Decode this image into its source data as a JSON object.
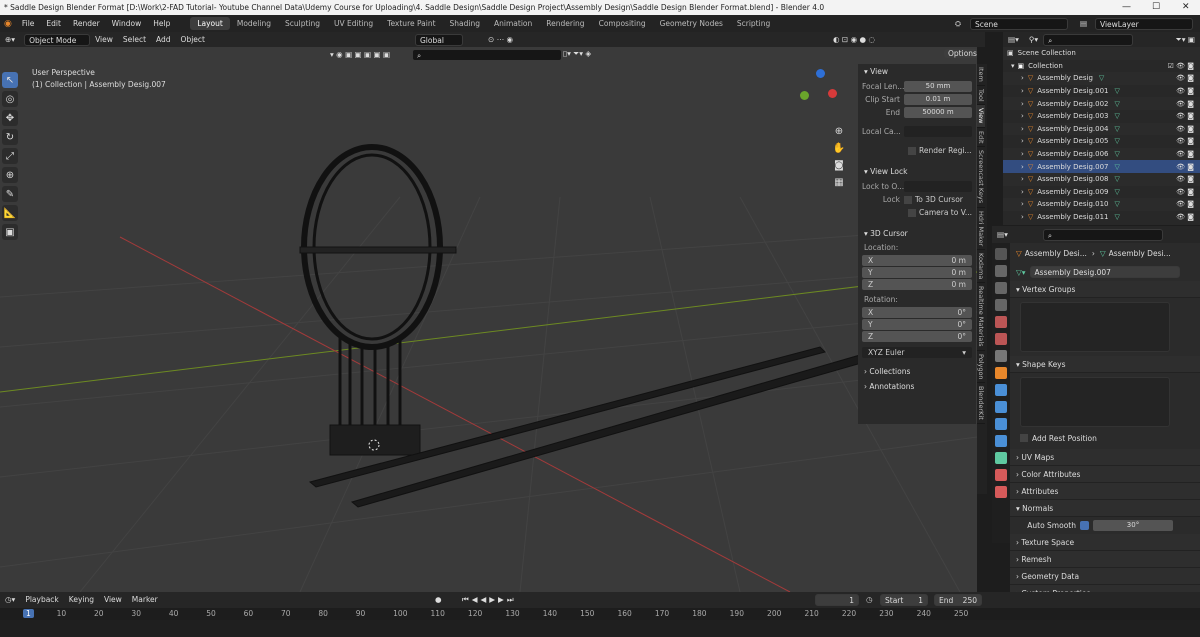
{
  "window": {
    "title": "* Saddle Design Blender Format [D:\\Work\\2-FAD Tutorial- Youtube Channel Data\\Udemy Course for Uploading\\4. Saddle Design\\Saddle Design Project\\Assembly Design\\Saddle Design Blender Format.blend] - Blender 4.0",
    "minimize": "—",
    "maximize": "☐",
    "close": "✕"
  },
  "menus": [
    "File",
    "Edit",
    "Render",
    "Window",
    "Help"
  ],
  "workspaces": [
    "Layout",
    "Modeling",
    "Sculpting",
    "UV Editing",
    "Texture Paint",
    "Shading",
    "Animation",
    "Rendering",
    "Compositing",
    "Geometry Nodes",
    "Scripting"
  ],
  "scene": {
    "name": "Scene",
    "view_layer": "ViewLayer"
  },
  "viewport_header": {
    "mode": "Object Mode",
    "view": "View",
    "select": "Select",
    "add": "Add",
    "object": "Object",
    "orientation": "Global",
    "options": "Options"
  },
  "viewport": {
    "perspective": "User Perspective",
    "collection_info": "(1) Collection | Assembly Desig.007"
  },
  "npanel": {
    "view_title": "View",
    "focal_label": "Focal Len...",
    "focal_value": "50 mm",
    "clip_start_label": "Clip Start",
    "clip_start_value": "0.01 m",
    "end_label": "End",
    "end_value": "50000 m",
    "local_cam_label": "Local Ca...",
    "render_region": "Render Regi...",
    "view_lock_title": "View Lock",
    "lock_to_label": "Lock to O...",
    "lock_label": "Lock",
    "to_3d_cursor": "To 3D Cursor",
    "camera_to_view": "Camera to V...",
    "cursor_title": "3D Cursor",
    "location_label": "Location:",
    "loc_x": "0 m",
    "loc_y": "0 m",
    "loc_z": "0 m",
    "rotation_label": "Rotation:",
    "rot_x": "0°",
    "rot_y": "0°",
    "rot_z": "0°",
    "euler": "XYZ Euler",
    "collections": "Collections",
    "annotations": "Annotations",
    "x": "X",
    "y": "Y",
    "z": "Z"
  },
  "vtabs": [
    "Item",
    "Tool",
    "View",
    "Edit",
    "Screencast Keys",
    "Hdri Maker",
    "Kodama",
    "Realtime Materials",
    "Polygon",
    "BlenderKit"
  ],
  "outliner": {
    "scene_collection": "Scene Collection",
    "collection": "Collection",
    "items": [
      "Assembly Desig",
      "Assembly Desig.001",
      "Assembly Desig.002",
      "Assembly Desig.003",
      "Assembly Desig.004",
      "Assembly Desig.005",
      "Assembly Desig.006",
      "Assembly Desig.007",
      "Assembly Desig.008",
      "Assembly Desig.009",
      "Assembly Desig.010",
      "Assembly Desig.011"
    ],
    "selected_index": 7
  },
  "properties": {
    "breadcrumb_obj": "Assembly Desi...",
    "breadcrumb_mesh": "Assembly Desi...",
    "mesh_name": "Assembly Desig.007",
    "vertex_groups": "Vertex Groups",
    "shape_keys": "Shape Keys",
    "add_rest_position": "Add Rest Position",
    "uv_maps": "UV Maps",
    "color_attributes": "Color Attributes",
    "attributes": "Attributes",
    "normals": "Normals",
    "auto_smooth": "Auto Smooth",
    "auto_smooth_angle": "30°",
    "texture_space": "Texture Space",
    "remesh": "Remesh",
    "geometry_data": "Geometry Data",
    "custom_properties": "Custom Properties"
  },
  "timeline": {
    "playback": "Playback",
    "keying": "Keying",
    "view": "View",
    "marker": "Marker",
    "current_frame": "1",
    "start_label": "Start",
    "start": "1",
    "end_label": "End",
    "end": "250",
    "ruler": [
      "1",
      "10",
      "20",
      "30",
      "40",
      "50",
      "60",
      "70",
      "80",
      "90",
      "100",
      "110",
      "120",
      "130",
      "140",
      "150",
      "160",
      "170",
      "180",
      "190",
      "200",
      "210",
      "220",
      "230",
      "240",
      "250"
    ]
  },
  "colors": {
    "accent": "#4772b3",
    "mesh_orange": "#e8872b",
    "mesh_green": "#5fc8a0",
    "x_axis": "#a33a3a",
    "y_axis": "#6d8a22"
  }
}
